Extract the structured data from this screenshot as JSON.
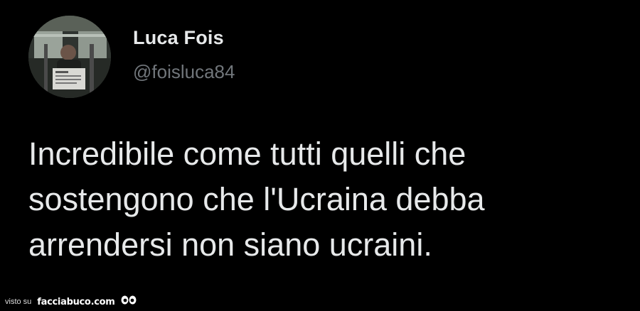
{
  "tweet": {
    "display_name": "Luca Fois",
    "handle": "@foisluca84",
    "text": "Incredibile come tutti quelli che\nsostengono che l'Ucraina debba\narrendersi non siano ucraini."
  },
  "watermark": {
    "prefix": "visto su",
    "site": "facciabuco.com"
  },
  "colors": {
    "background": "#000000",
    "primary_text": "#e7e9ea",
    "secondary_text": "#71767b"
  },
  "icons": {
    "avatar": "profile-photo",
    "watermark_logo": "eyes-icon"
  }
}
